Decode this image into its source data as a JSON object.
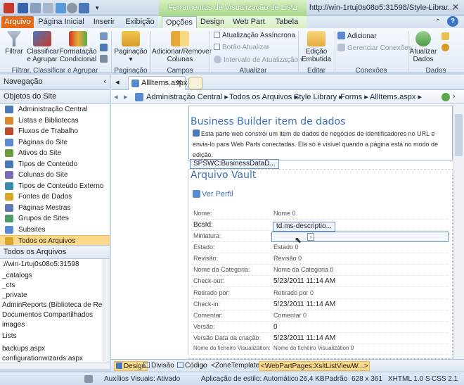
{
  "titlebar": {
    "context_title": "Ferramentas de Visualização de Lista",
    "window_title": "http://win-1rtuj0s08o5:31598/Style Librar..."
  },
  "tabs": [
    "Arquivo",
    "Página Inicial",
    "Inserir",
    "Exibição",
    "Opções",
    "Design",
    "Web Part",
    "Tabela"
  ],
  "ribbon": {
    "filtrar": "Filtrar",
    "classificar": "Classificar",
    "agrupar": "e Agrupar",
    "formatacao": "Formatação",
    "condicional": "Condicional",
    "group1": "Filtrar, Classificar e Agrupar",
    "paginacao": "Paginação",
    "group2": "Paginação",
    "add_remove": "Adicionar/Remover",
    "colunas": "Colunas",
    "group3": "Campos",
    "atualizacao_assincrona": "Atualização Assíncrona",
    "botao_atualizar": "Botão Atualizar",
    "intervalo": "Intervalo de Atualização",
    "group4": "Atualizar",
    "edicao": "Edição",
    "embutida": "Embutida",
    "group5": "Editar",
    "adicionar": "Adicionar",
    "gerenciar": "Gerenciar Conexões",
    "group6": "Conexões",
    "atualizar_dados_1": "Atualizar",
    "atualizar_dados_2": "Dados",
    "group7": "Dados"
  },
  "nav": {
    "header": "Navegação",
    "site_objects": "Objetos do Site",
    "items": [
      "Administração Central",
      "Listas e Bibliotecas",
      "Fluxos de Trabalho",
      "Páginas do Site",
      "Ativos do Site",
      "Tipos de Conteúdo",
      "Colunas do Site",
      "Tipos de Conteúdo Externo",
      "Fontes de Dados",
      "Páginas Mestras",
      "Grupos de Sites",
      "Subsites",
      "Todos os Arquivos"
    ],
    "item_colors": [
      "#4a78b8",
      "#d9882a",
      "#c0482c",
      "#5a8ad0",
      "#6c9b3a",
      "#4a78b8",
      "#7a6ab8",
      "#3a8ab0",
      "#d9a52a",
      "#5a7ab8",
      "#4a9a6a",
      "#5a8ad0",
      "#d9a52a"
    ],
    "all_files": "Todos os Arquivos",
    "files": [
      "://win-1rtuj0s08o5:31598",
      "_catalogs",
      "_cts",
      "_private",
      "AdminReports (Biblioteca de Relatório",
      "Documentos Compartilhados",
      "images",
      "Lists",
      "backups.aspx",
      "configurationwizards.aspx"
    ]
  },
  "doc": {
    "tab_label": "AllItems.aspx",
    "crumbs": [
      "Administração Central",
      "Todos os Arquivos",
      "Style Library",
      "Forms",
      "AllItems.aspx"
    ]
  },
  "canvas": {
    "bb_title": "Business Builder item de dados",
    "bb_desc": "Esta parte web constrói um item de dados de negócios de identificadores no URL e envia-lo para Web Parts conectadas. Ela só é visível quando a página está no modo de edição.",
    "bb_tag": "SPSWC:BusinessDataD...",
    "vault_title": "Arquivo Vault",
    "ver_perfil": "Ver Perfil",
    "td_tag": "td.ms-descriptio...",
    "fields": [
      {
        "label": "Nome:",
        "value": "Nome 0"
      },
      {
        "label": "BcsId:",
        "value": ""
      },
      {
        "label": "Miniatura:",
        "value": "Miniatura 0"
      },
      {
        "label": "Estado:",
        "value": "Estado 0"
      },
      {
        "label": "Revisão:",
        "value": "Revisão 0"
      },
      {
        "label": "Nome da Categoria:",
        "value": "Nome da Categoria 0"
      },
      {
        "label": "Check-out:",
        "value": "5/23/2011 11:14 AM"
      },
      {
        "label": "Retirado por:",
        "value": "Retirado por 0"
      },
      {
        "label": "Check-in:",
        "value": "5/23/2011 11:14 AM"
      },
      {
        "label": "Comentar:",
        "value": "Comentar 0"
      },
      {
        "label": "Versão:",
        "value": "0"
      },
      {
        "label": "Versão Data da criação:",
        "value": "5/23/2011 11:14 AM"
      },
      {
        "label": "Nome do ficheiro Visualization:",
        "value": "Nome do ficheiro Visualization 0"
      }
    ]
  },
  "viewtabs": {
    "design": "Design",
    "divisao": "Divisão",
    "codigo": "Código",
    "zone": "<ZoneTemplate>",
    "webpart": "<WebPartPages:XsltListViewW...>"
  },
  "status": {
    "auxilios": "Auxílios Visuais: Ativado",
    "aplicacao": "Aplicação de estilo: Automático",
    "size": "26,4 KB",
    "padrao": "Padrão",
    "dims": "628 x 361",
    "xhtml": "XHTML 1.0 S",
    "css": "CSS 2.1"
  }
}
